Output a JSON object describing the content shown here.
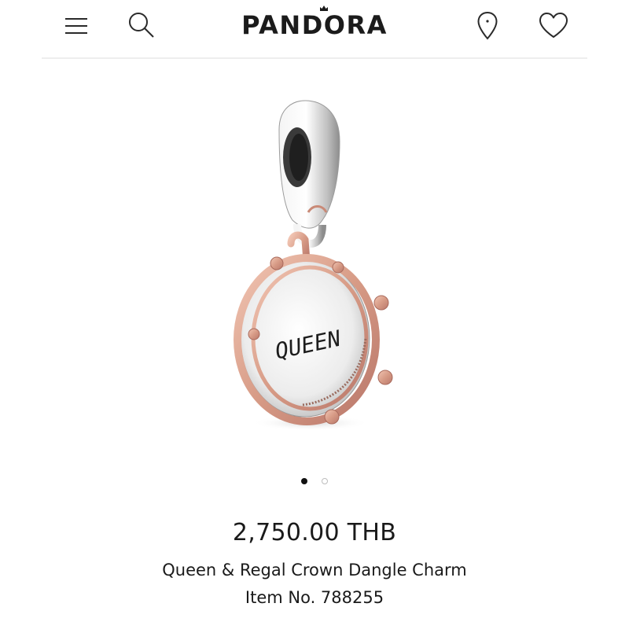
{
  "header": {
    "brand": "PANDORA",
    "icons": [
      "menu-icon",
      "search-icon",
      "location-pin-icon",
      "heart-icon"
    ]
  },
  "product": {
    "image_text": "QUEEN",
    "price": "2,750.00 THB",
    "name": "Queen & Regal Crown Dangle Charm",
    "item_number": "Item No. 788255"
  },
  "carousel": {
    "total": 2,
    "active_index": 1
  },
  "colors": {
    "text": "#1a1a1a",
    "rose_gold": "#d79b86",
    "silver": "#c8c8c8",
    "divider": "#eeeeee"
  }
}
